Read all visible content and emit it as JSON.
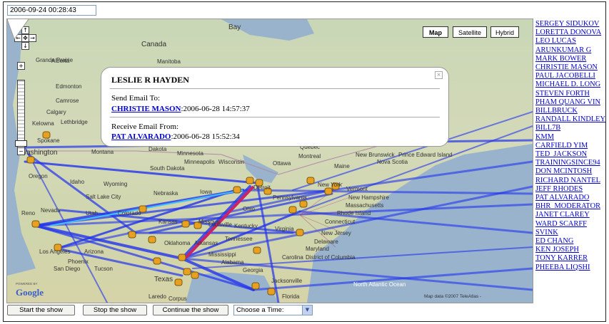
{
  "timestamp_value": "2006-09-24 00:28:43",
  "map": {
    "type_buttons": [
      "Map",
      "Satellite",
      "Hybrid"
    ],
    "selected_type": "Map",
    "labels": [
      "Bay",
      "Canada",
      "Manitoba",
      "Alberta",
      "Grande Prairie",
      "Edmonton",
      "Camrose",
      "Calgary",
      "Lethbridge",
      "Kelowna",
      "Spokane",
      "Montana",
      "Dakota",
      "Minnesota",
      "South Dakota",
      "Wisconsin",
      "Oregon",
      "Idaho",
      "Wyoming",
      "Nebraska",
      "Iowa",
      "Salt Lake City",
      "Nevada",
      "Utah",
      "Reno",
      "Colorado",
      "Kansas",
      "Missouri",
      "Oklahoma",
      "Arkansas",
      "Arizona",
      "Phoenix",
      "Tucson",
      "Los Angeles",
      "San Diego",
      "Mississippi",
      "Alabama",
      "Georgia",
      "Carolina",
      "Florida",
      "Jacksonville",
      "Texas",
      "Laredo",
      "Corpus",
      "New York",
      "Montreal",
      "Ottawa",
      "Quebec",
      "Maine",
      "New Brunswick",
      "Nova Scotia",
      "Prince Edward Island",
      "Vermont",
      "New Hampshire",
      "Massachusetts",
      "Rhode Island",
      "Connecticut",
      "New Jersey",
      "Delaware",
      "Maryland",
      "District of Columbia",
      "Pennsylvania",
      "Ohio",
      "Kentucky",
      "Louisville",
      "Virginia",
      "Tennessee",
      "Detroit",
      "North Atlantic Ocean",
      "Minneapolis",
      "Washington"
    ],
    "powered_by": "POWERED BY",
    "google": "Google",
    "attribution": "Map data ©2007 TeleAtlas -"
  },
  "popup": {
    "title": "LESLIE R HAYDEN",
    "send_label": "Send Email To:",
    "send_to": "CHRISTIE MASON",
    "send_time": ":2006-06-28 14:57:37",
    "receive_label": "Receive Email From:",
    "receive_from": "PAT ALVARADO",
    "receive_time": ":2006-06-28 15:52:34"
  },
  "people": [
    "SERGEY SIDUKOV",
    "LORETTA DONOVA",
    "LEO LUCAS",
    "ARUNKUMAR G",
    "MARK BOWER",
    "CHRISTIE MASON",
    "PAUL JACOBELLI",
    "MICHAEL D. LONG",
    "STEVEN FORTH",
    "PHAM QUANG VIN",
    "BILLBRUCK",
    "RANDALL KINDLEY",
    "BILL7B",
    "KMM",
    "CARFIELD YIM",
    "TED_JACKSON",
    "TRAININGSINCE94",
    "DON MCINTOSH",
    "RICHARD NANTEL",
    "JEFF RHODES",
    "PAT ALVARADO",
    "BHR_MODERATOR",
    "JANET CLAREY",
    "WARD SCARFF",
    "SVINK",
    "ED CHANG",
    "KEN JOSEPH",
    "TONY KARRER",
    "PHEEBA LIQSHI"
  ],
  "controls": {
    "start": "Start the show",
    "stop": "Stop the show",
    "continue": "Continue the show",
    "select_value": "Choose a Time:"
  },
  "colors": {
    "link": "#0000cc",
    "edge": "#2233ee",
    "highlight_edge": "#cc2266",
    "node": "#e8a020"
  }
}
